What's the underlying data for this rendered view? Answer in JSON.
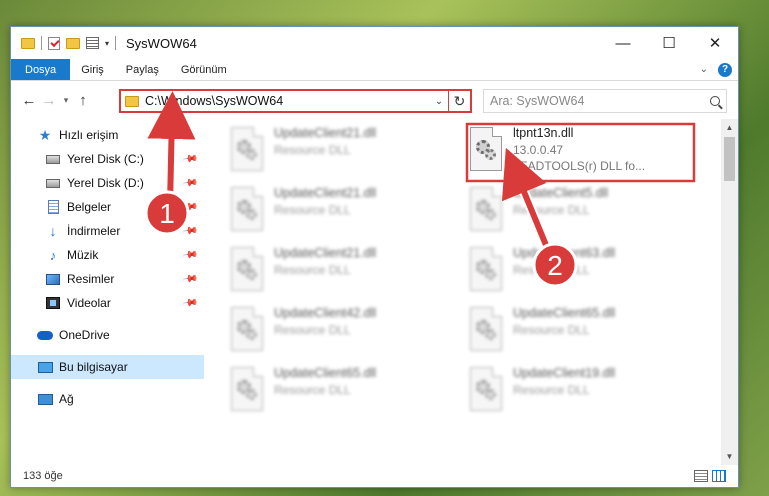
{
  "window": {
    "title": "SysWOW64",
    "controls": {
      "minimize": "—",
      "maximize": "☐",
      "close": "✕"
    }
  },
  "ribbon": {
    "tabs": [
      {
        "label": "Dosya"
      },
      {
        "label": "Giriş"
      },
      {
        "label": "Paylaş"
      },
      {
        "label": "Görünüm"
      }
    ],
    "help": "?"
  },
  "address": {
    "path": "C:\\Windows\\SysWOW64",
    "refresh": "↻",
    "search_placeholder": "Ara: SysWOW64"
  },
  "sidebar": {
    "items": [
      {
        "label": "Hızlı erişim",
        "icon": "star-icon"
      },
      {
        "label": "Yerel Disk (C:)",
        "icon": "disk-icon",
        "pinned": true
      },
      {
        "label": "Yerel Disk (D:)",
        "icon": "disk-icon",
        "pinned": true
      },
      {
        "label": "Belgeler",
        "icon": "documents-icon",
        "pinned": true
      },
      {
        "label": "İndirmeler",
        "icon": "downloads-icon",
        "pinned": true
      },
      {
        "label": "Müzik",
        "icon": "music-icon",
        "pinned": true
      },
      {
        "label": "Resimler",
        "icon": "pictures-icon",
        "pinned": true
      },
      {
        "label": "Videolar",
        "icon": "videos-icon",
        "pinned": true
      },
      {
        "label": "OneDrive",
        "icon": "onedrive-icon"
      },
      {
        "label": "Bu bilgisayar",
        "icon": "this-pc-icon",
        "selected": true
      },
      {
        "label": "Ağ",
        "icon": "network-icon"
      }
    ]
  },
  "files": {
    "highlighted": {
      "name": "ltpnt13n.dll",
      "version": "13.0.0.47",
      "description": "LEADTOOLS(r) DLL fo..."
    },
    "left_column": [
      {
        "name": "UpdateClient21.dll",
        "type": "Resource DLL"
      },
      {
        "name": "UpdateClient21.dll",
        "type": "Resource DLL"
      },
      {
        "name": "UpdateClient21.dll",
        "type": "Resource DLL"
      },
      {
        "name": "UpdateClient42.dll",
        "type": "Resource DLL"
      },
      {
        "name": "UpdateClient65.dll",
        "type": "Resource DLL"
      }
    ],
    "right_column": [
      {
        "name": "UpdateClient5.dll",
        "type": "Resource DLL"
      },
      {
        "name": "UpdateClient63.dll",
        "type": "Resource DLL"
      },
      {
        "name": "UpdateClient65.dll",
        "type": "Resource DLL"
      },
      {
        "name": "UpdateClient19.dll",
        "type": "Resource DLL"
      }
    ]
  },
  "status": {
    "item_count": "133 öğe"
  },
  "annotations": {
    "step1": "1",
    "step2": "2",
    "color": "#d93a3a"
  }
}
